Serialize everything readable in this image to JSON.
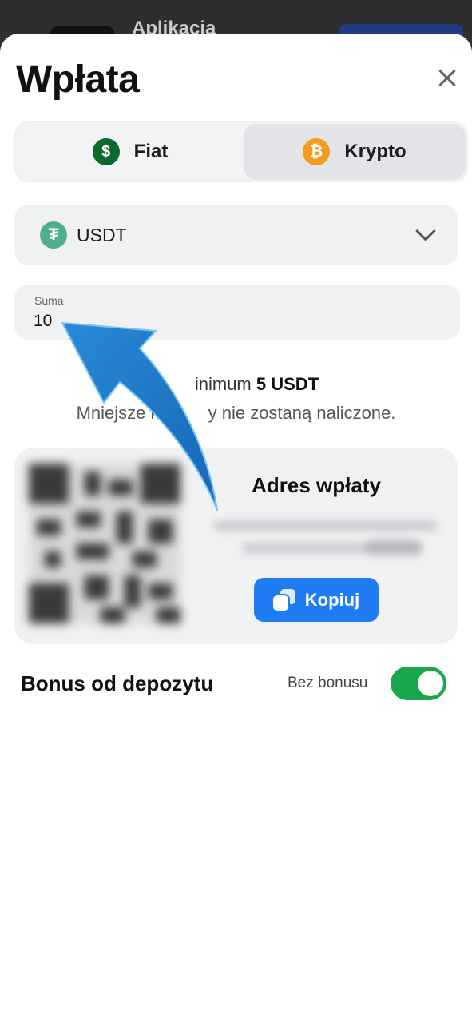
{
  "background": {
    "app_title": "Aplikacja"
  },
  "sheet": {
    "title": "Wpłata",
    "close_icon": "close-icon"
  },
  "tabs": [
    {
      "label": "Fiat",
      "icon": "dollar-coin-icon",
      "icon_glyph": "$",
      "selected": false
    },
    {
      "label": "Krypto",
      "icon": "bitcoin-icon",
      "icon_glyph": "₿",
      "selected": true
    }
  ],
  "currency_select": {
    "icon": "tether-icon",
    "icon_glyph": "₮",
    "value": "USDT"
  },
  "amount": {
    "label": "Suma",
    "value": "10"
  },
  "info": {
    "minimum_prefix": "inimum",
    "minimum_value": "5 USDT",
    "note": "Mniejsze k          y nie zostaną naliczone."
  },
  "deposit_address": {
    "title": "Adres wpłaty",
    "copy_label": "Kopiuj"
  },
  "bonus": {
    "title": "Bonus od depozytu",
    "state_label": "Bez bonusu",
    "enabled": true
  },
  "colors": {
    "primary": "#1f7cf2",
    "toggle_on": "#1aa64b",
    "arrow": "#1e7ac6",
    "fiat_coin": "#0b6a2f",
    "bitcoin": "#f59a1f",
    "tether": "#4fae8e"
  }
}
